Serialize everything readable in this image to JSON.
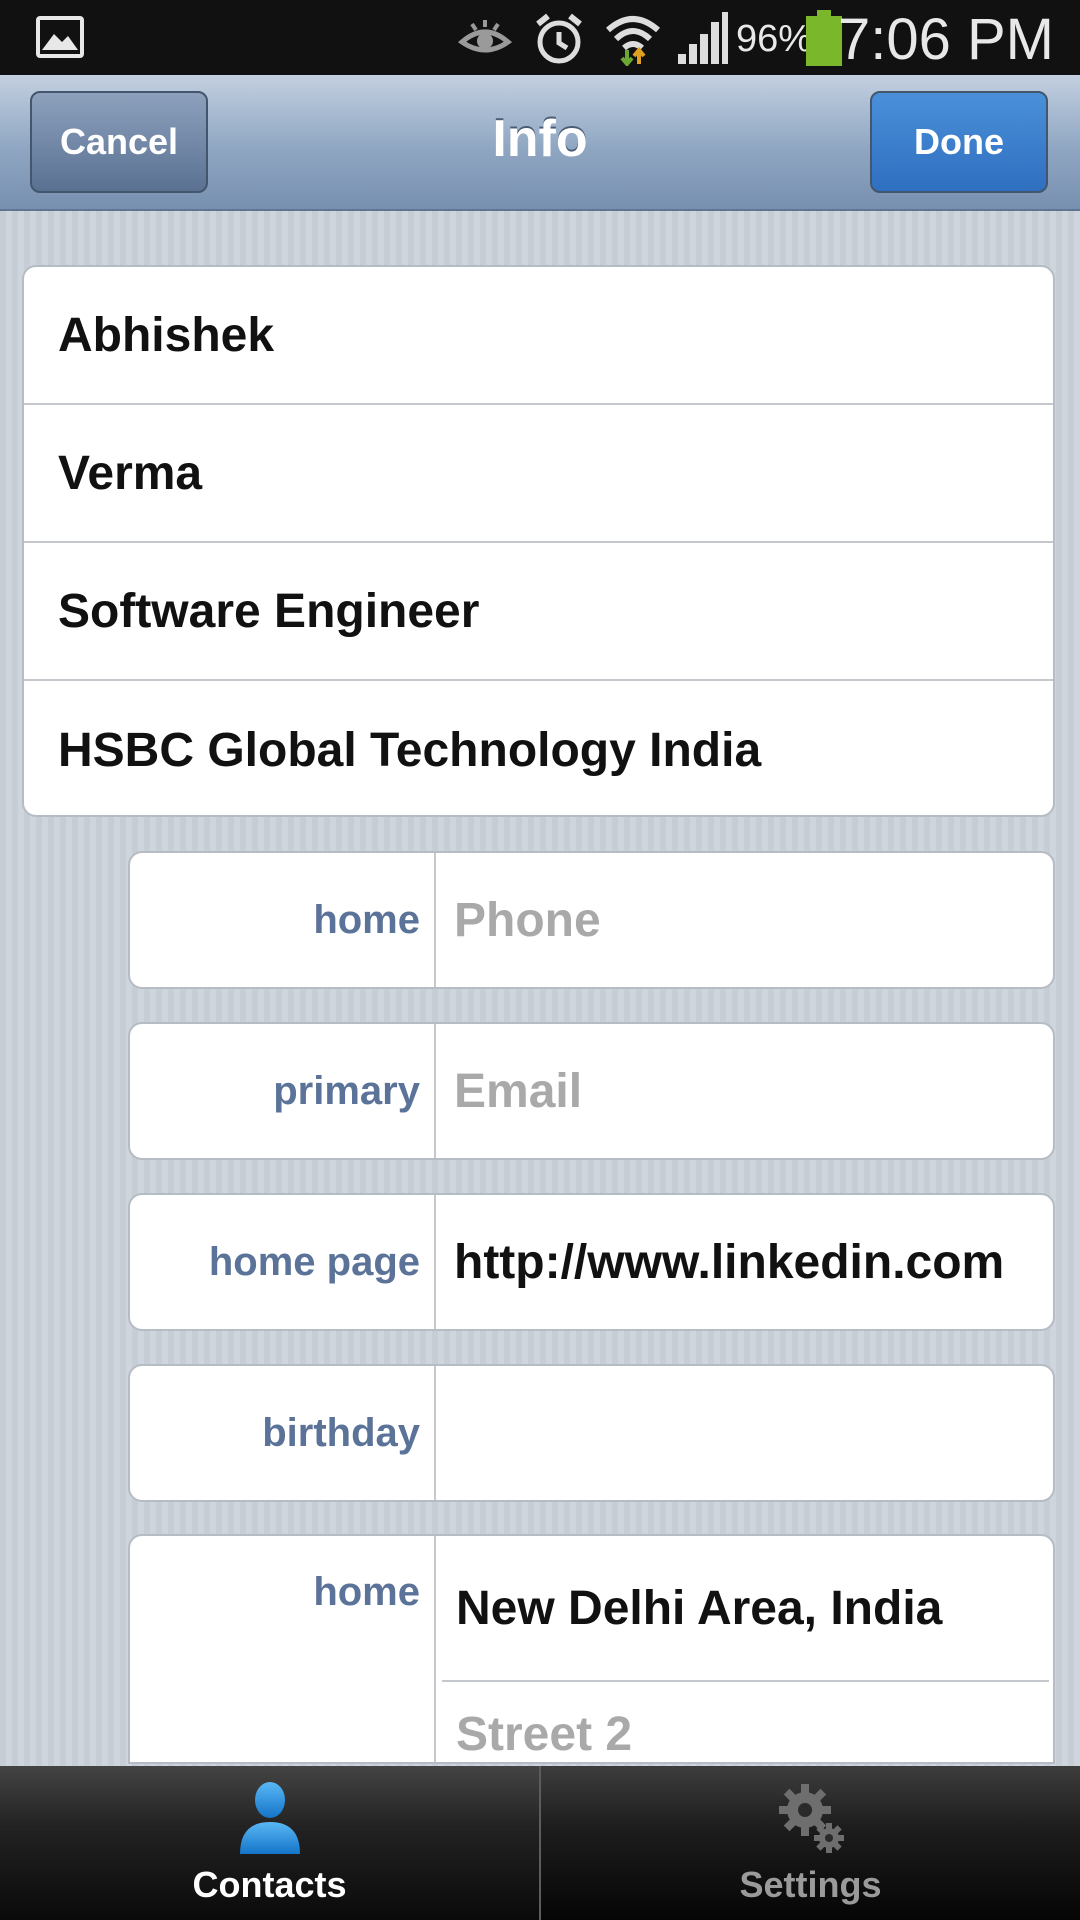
{
  "status_bar": {
    "battery_percent": "96%",
    "time": "7:06 PM",
    "icons": [
      "gallery-icon",
      "eye-icon",
      "alarm-icon",
      "wifi-icon",
      "signal-icon",
      "battery-icon"
    ]
  },
  "navbar": {
    "title": "Info",
    "cancel_label": "Cancel",
    "done_label": "Done"
  },
  "name_fields": [
    "Abhishek",
    "Verma",
    "Software Engineer",
    "HSBC Global Technology India"
  ],
  "fields": {
    "phone": {
      "label": "home",
      "placeholder": "Phone"
    },
    "email": {
      "label": "primary",
      "placeholder": "Email"
    },
    "homepage": {
      "label": "home page",
      "value": "http://www.linkedin.com"
    },
    "birthday": {
      "label": "birthday",
      "value": ""
    },
    "address": {
      "label": "home",
      "line1": "New Delhi Area, India",
      "line2_placeholder": "Street 2"
    }
  },
  "tabs": [
    {
      "label": "Contacts",
      "icon": "person-icon",
      "active": true
    },
    {
      "label": "Settings",
      "icon": "gear-icon",
      "active": false
    }
  ],
  "colors": {
    "done_button": "#3a80cf",
    "label_blue": "#5b7398",
    "contacts_icon": "#1e8fe0"
  }
}
